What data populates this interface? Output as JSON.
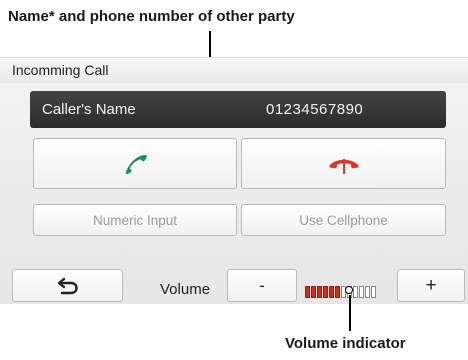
{
  "annotations": {
    "top_callout": "Name* and phone number of other party",
    "bottom_callout": "Volume indicator"
  },
  "window": {
    "title": "Incomming Call"
  },
  "caller": {
    "name": "Caller's Name",
    "number": "01234567890"
  },
  "buttons": {
    "answer_icon": "phone-answer-icon",
    "reject_icon": "phone-hangup-icon",
    "numeric_input": "Numeric Input",
    "use_cellphone": "Use Cellphone",
    "back_icon": "back-arrow-icon",
    "volume_down": "-",
    "volume_up": "+"
  },
  "volume": {
    "label": "Volume",
    "level": 6,
    "max": 12
  },
  "colors": {
    "answer": "#1e8a6a",
    "reject": "#e0352b",
    "volume_on": "#d62a1e"
  }
}
